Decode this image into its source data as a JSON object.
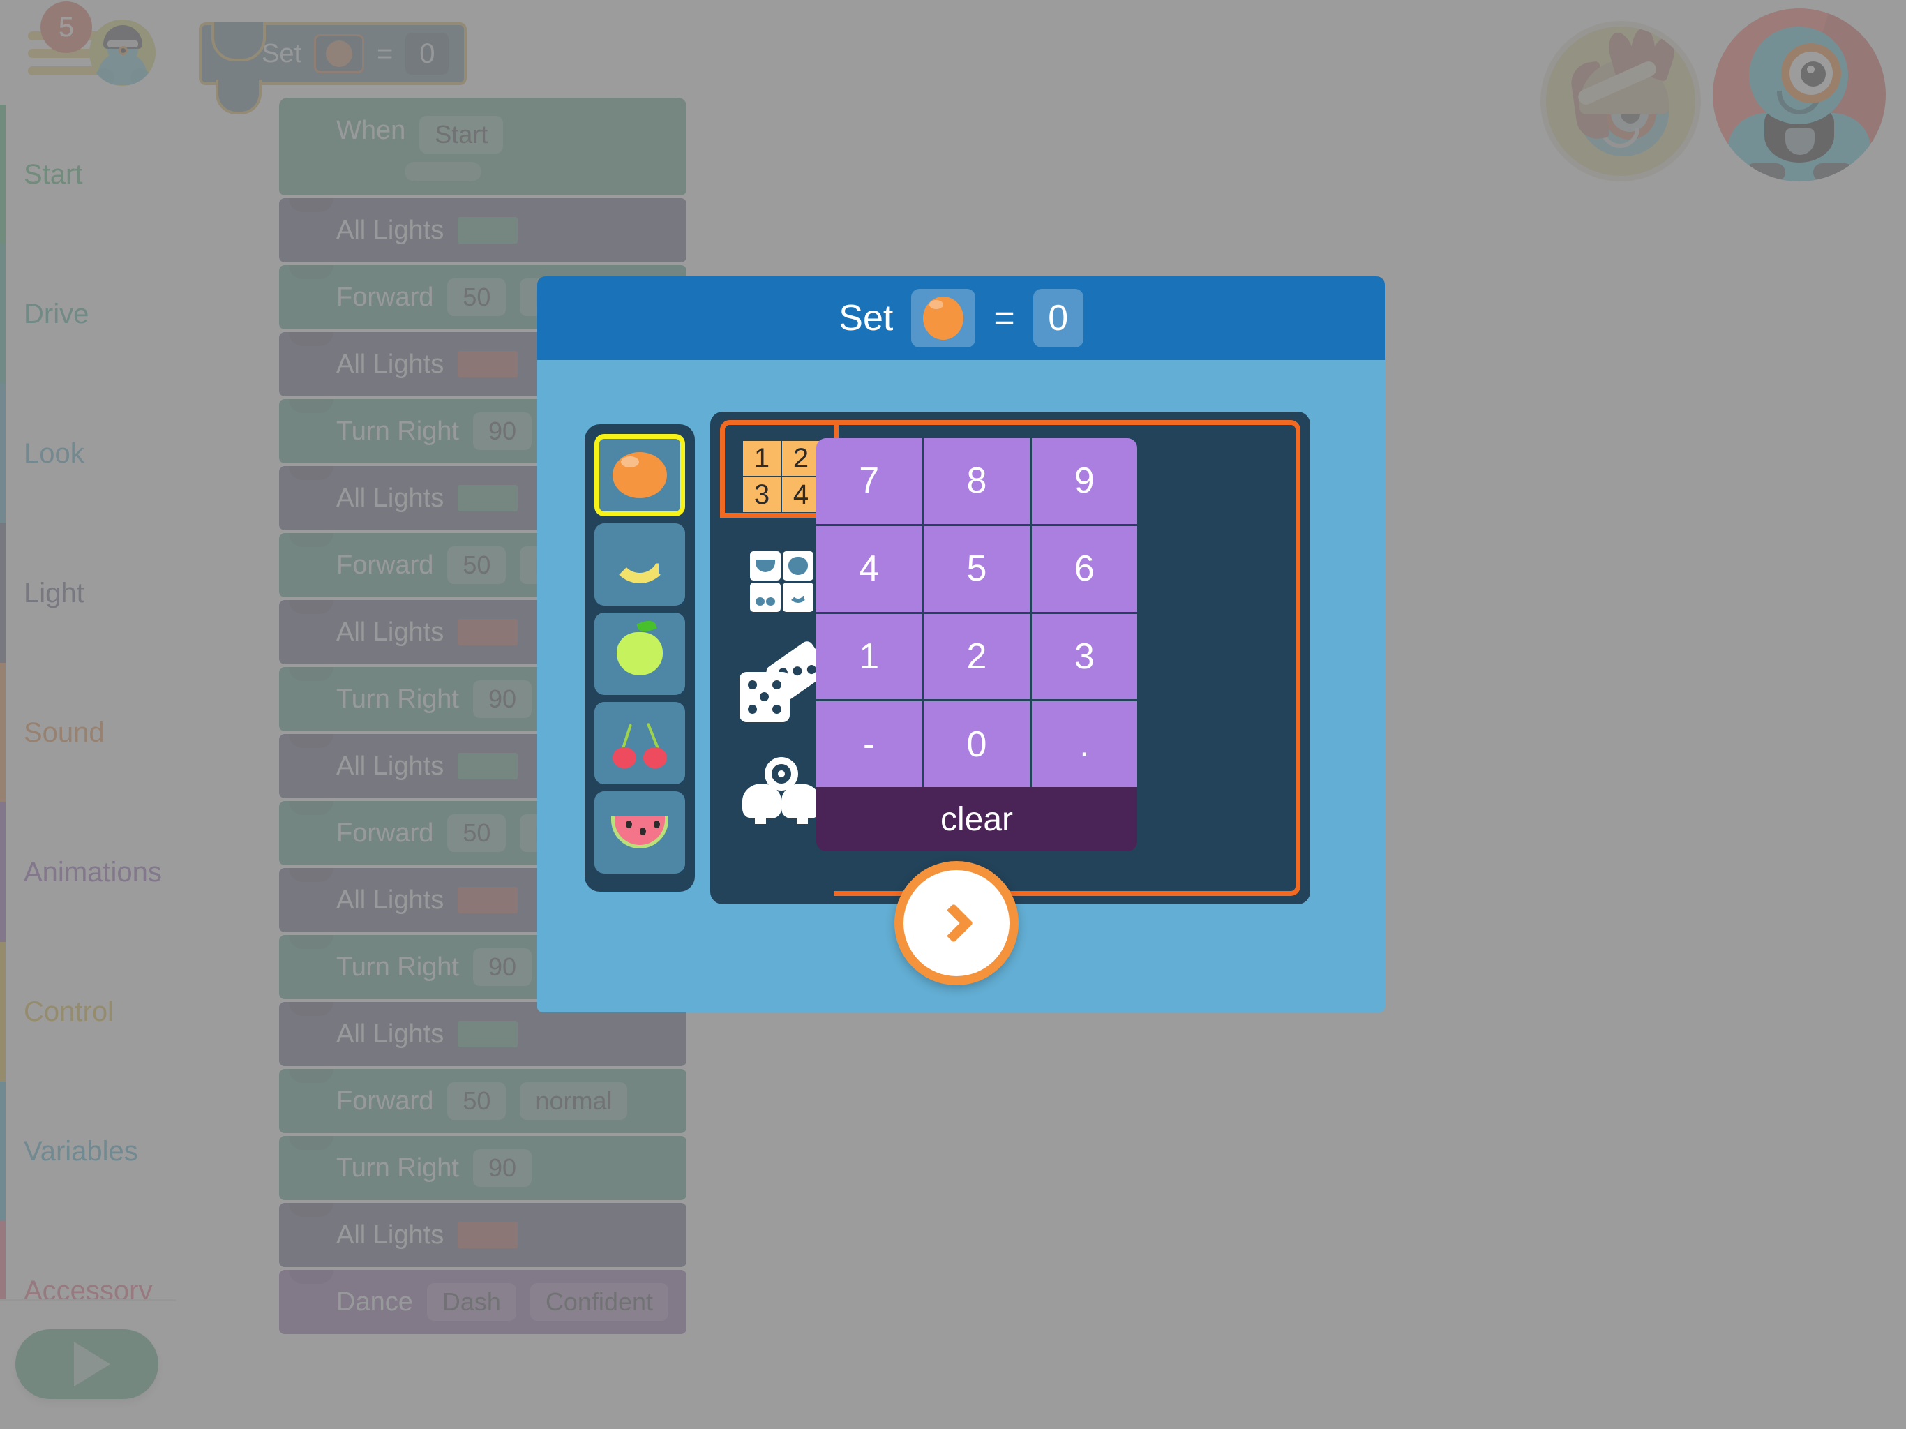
{
  "topbar": {
    "menu_icon": "hamburger-menu-icon",
    "badge_count": "5",
    "user_avatar_icon": "robot-helmet-avatar-icon",
    "robots": [
      {
        "name": "dot-robot-avatar",
        "label": "Dot",
        "active": false,
        "bg": "#d7cf8c"
      },
      {
        "name": "dash-robot-avatar",
        "label": "Dash",
        "active": true,
        "bg": "#ff6a61"
      }
    ]
  },
  "sidebar": {
    "items": [
      {
        "label": "Start",
        "color": "#3cb371",
        "accent": "#3cb371"
      },
      {
        "label": "Drive",
        "color": "#3fae96",
        "accent": "#3fae96"
      },
      {
        "label": "Look",
        "color": "#4aa8c4",
        "accent": "#4aa8c4"
      },
      {
        "label": "Light",
        "color": "#5b5a86",
        "accent": "#5b5a86"
      },
      {
        "label": "Sound",
        "color": "#e8893f",
        "accent": "#e8893f"
      },
      {
        "label": "Animations",
        "color": "#8e58b8",
        "accent": "#8e58b8"
      },
      {
        "label": "Control",
        "color": "#ddb62e",
        "accent": "#ddb62e"
      },
      {
        "label": "Variables",
        "color": "#3ba7c8",
        "accent": "#3ba7c8"
      },
      {
        "label": "Accessory",
        "color": "#e9607a",
        "accent": "#e9607a"
      }
    ],
    "play_button_label": "play-program"
  },
  "drag_block": {
    "label": "Set",
    "equals": "=",
    "value": "0",
    "icon": "orange-fruit-icon"
  },
  "program": {
    "blocks": [
      {
        "kind": "start",
        "label": "When",
        "chip": "Start",
        "extra": "empty-slot"
      },
      {
        "kind": "light",
        "label": "All Lights",
        "swatch": "#4f9e7f"
      },
      {
        "kind": "drive",
        "label": "Forward",
        "chip": "50",
        "chip2": "normal"
      },
      {
        "kind": "light",
        "label": "All Lights",
        "swatch": "#b35a52"
      },
      {
        "kind": "drive",
        "label": "Turn Right",
        "chip": "90"
      },
      {
        "kind": "light",
        "label": "All Lights",
        "swatch": "#4f9e7f"
      },
      {
        "kind": "drive",
        "label": "Forward",
        "chip": "50",
        "chip2": "normal"
      },
      {
        "kind": "light",
        "label": "All Lights",
        "swatch": "#b35a52"
      },
      {
        "kind": "drive",
        "label": "Turn Right",
        "chip": "90"
      },
      {
        "kind": "light",
        "label": "All Lights",
        "swatch": "#4f9e7f"
      },
      {
        "kind": "drive",
        "label": "Forward",
        "chip": "50",
        "chip2": "normal"
      },
      {
        "kind": "light",
        "label": "All Lights",
        "swatch": "#b35a52"
      },
      {
        "kind": "drive",
        "label": "Turn Right",
        "chip": "90"
      },
      {
        "kind": "light",
        "label": "All Lights",
        "swatch": "#4f9e7f"
      },
      {
        "kind": "drive",
        "label": "Forward",
        "chip": "50",
        "chip2": "normal"
      },
      {
        "kind": "drive",
        "label": "Turn Right",
        "chip": "90"
      },
      {
        "kind": "light",
        "label": "All Lights",
        "swatch": "#b35a52"
      },
      {
        "kind": "anim",
        "label": "Dance",
        "chip": "Dash",
        "chip2": "Confident"
      }
    ]
  },
  "modal": {
    "header": {
      "set_label": "Set",
      "equals_label": "=",
      "value": "0",
      "icon": "orange-fruit-icon",
      "bg": "#1a73b8"
    },
    "variable_picker": {
      "selected_index": 0,
      "options": [
        {
          "icon": "orange-fruit-icon",
          "label": "orange"
        },
        {
          "icon": "banana-fruit-icon",
          "label": "banana"
        },
        {
          "icon": "apple-fruit-icon",
          "label": "apple"
        },
        {
          "icon": "cherries-fruit-icon",
          "label": "cherries"
        },
        {
          "icon": "watermelon-fruit-icon",
          "label": "watermelon"
        }
      ]
    },
    "input_mode_tabs": {
      "selected_index": 0,
      "tabs": [
        {
          "icon": "number-keypad-tab-icon",
          "label": "numbers",
          "cells": [
            "1",
            "2",
            "3",
            "4"
          ]
        },
        {
          "icon": "fruit-grid-tab-icon",
          "label": "fruit"
        },
        {
          "icon": "dice-tab-icon",
          "label": "dice"
        },
        {
          "icon": "robot-tab-icon",
          "label": "robot"
        }
      ]
    },
    "keypad": {
      "keys": [
        "7",
        "8",
        "9",
        "4",
        "5",
        "6",
        "1",
        "2",
        "3",
        "-",
        "0",
        "."
      ],
      "clear_label": "clear",
      "key_color": "#ab7fe0",
      "clear_color": "#4b2457"
    },
    "next_button": {
      "icon": "chevron-right-icon",
      "color": "#f5933c"
    }
  }
}
